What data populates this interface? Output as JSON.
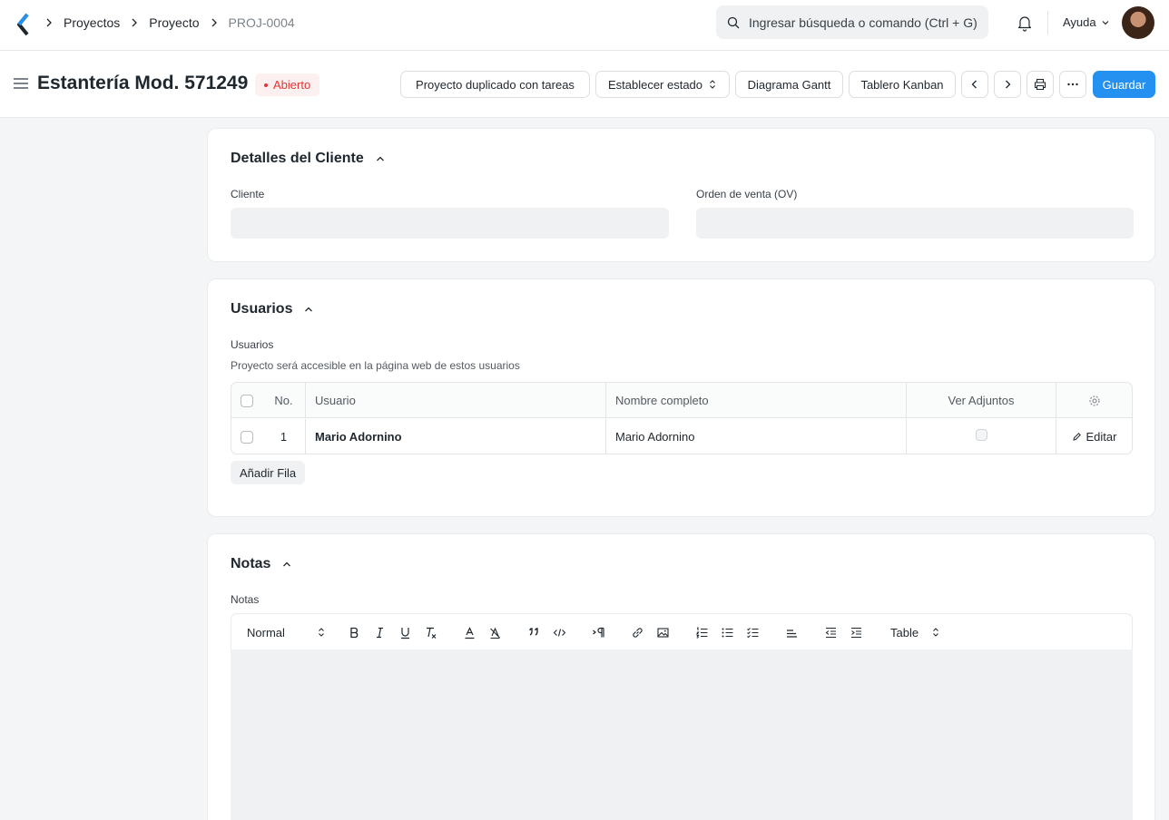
{
  "navbar": {
    "breadcrumbs": [
      "Proyectos",
      "Proyecto",
      "PROJ-0004"
    ],
    "search_placeholder": "Ingresar búsqueda o comando (Ctrl + G)",
    "help_label": "Ayuda"
  },
  "header": {
    "title": "Estantería Mod. 571249",
    "status": "Abierto",
    "status_color": "#e03636",
    "buttons": {
      "duplicate": "Proyecto duplicado con tareas",
      "set_status": "Establecer estado",
      "gantt": "Diagrama Gantt",
      "kanban": "Tablero Kanban",
      "save": "Guardar"
    },
    "accent_color": "#2490ef"
  },
  "customer_section": {
    "title": "Detalles del Cliente",
    "customer_label": "Cliente",
    "customer_value": "",
    "sales_order_label": "Orden de venta (OV)",
    "sales_order_value": ""
  },
  "users_section": {
    "title": "Usuarios",
    "field_label": "Usuarios",
    "description": "Proyecto será accesible en la página web de estos usuarios",
    "columns": [
      "No.",
      "Usuario",
      "Nombre completo",
      "Ver Adjuntos"
    ],
    "rows": [
      {
        "no": "1",
        "user": "Mario Adornino",
        "full_name": "Mario Adornino",
        "view_attachments": false,
        "edit_label": "Editar"
      }
    ],
    "add_row_label": "Añadir Fila"
  },
  "notes_section": {
    "title": "Notas",
    "field_label": "Notas",
    "format_select": "Normal",
    "table_select": "Table",
    "content": ""
  }
}
